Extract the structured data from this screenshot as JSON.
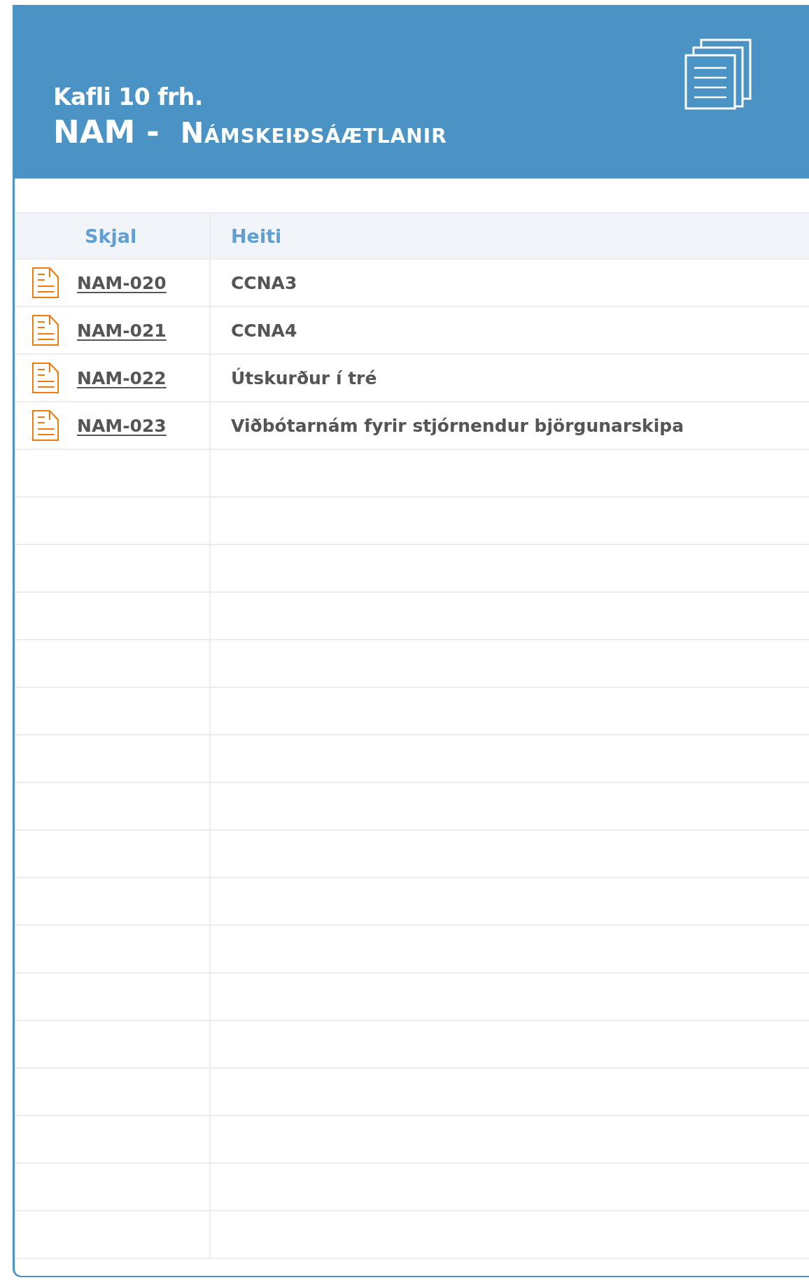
{
  "header": {
    "chapter": "Kafli 10 frh.",
    "code": "NAM -",
    "title": "Námskeiðsáætlanir"
  },
  "table": {
    "columns": [
      "Skjal",
      "Heiti"
    ],
    "rows": [
      {
        "document": "NAM-020",
        "name": "CCNA3"
      },
      {
        "document": "NAM-021",
        "name": "CCNA4"
      },
      {
        "document": "NAM-022",
        "name": "Útskurður í tré"
      },
      {
        "document": "NAM-023",
        "name": "Viðbótarnám fyrir stjórnendur björgunarskipa"
      }
    ]
  }
}
